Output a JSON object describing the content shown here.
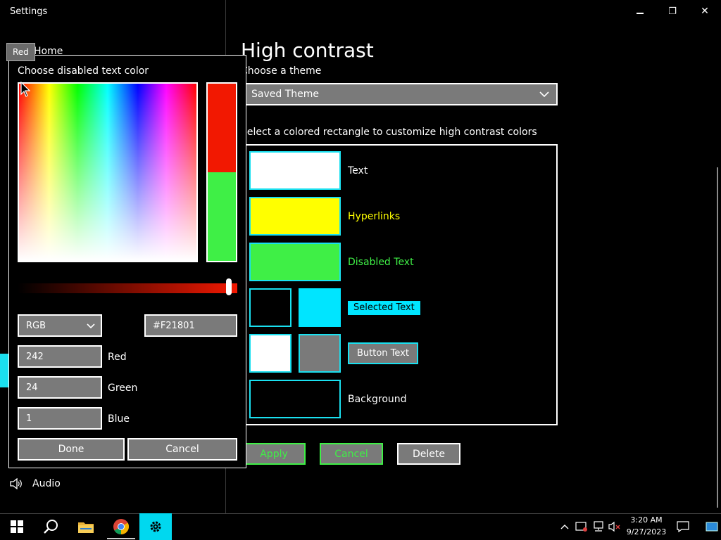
{
  "window": {
    "title": "Settings",
    "minimize_glyph": "–",
    "maximize_glyph": "❐",
    "close_glyph": "✕"
  },
  "sidebar": {
    "home_label": "Home",
    "audio_label": "Audio"
  },
  "tooltip": {
    "text": "Red"
  },
  "dialog": {
    "title": "Choose disabled text color",
    "mode_value": "RGB",
    "hex_value": "#F21801",
    "red_value": "242",
    "red_label": "Red",
    "green_value": "24",
    "green_label": "Green",
    "blue_value": "1",
    "blue_label": "Blue",
    "done_label": "Done",
    "cancel_label": "Cancel",
    "new_color": "#F21801",
    "old_color": "#3FEF46",
    "brightness_slider": 1.0
  },
  "page": {
    "title": "High contrast",
    "choose_theme_label": "Choose a theme",
    "theme_value": "Saved Theme",
    "instruction": "Select a colored rectangle to customize high contrast colors",
    "rows": {
      "text_label": "Text",
      "hyperlinks_label": "Hyperlinks",
      "disabled_label": "Disabled Text",
      "selected_label": "Selected Text",
      "button_label": "Button Text",
      "background_label": "Background"
    },
    "apply_label": "Apply",
    "cancel_label": "Cancel",
    "delete_label": "Delete"
  },
  "colors": {
    "text": "#ffffff",
    "hyperlinks": "#ffff00",
    "disabled": "#3fef46",
    "selected_bg": "#00e5ff",
    "button_face": "#7a7a7a",
    "background": "#000000",
    "accent": "#1ae0f0"
  },
  "taskbar": {
    "time": "3:20 AM",
    "date": "9/27/2023",
    "icons": [
      "windows-start-icon",
      "search-icon",
      "file-explorer-icon",
      "chrome-icon",
      "settings-icon"
    ]
  }
}
